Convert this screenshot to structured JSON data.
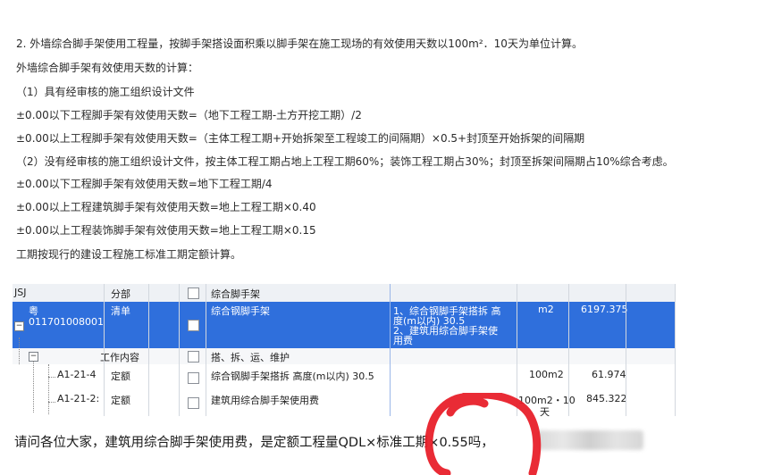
{
  "text_lines": [
    "2. 外墙综合脚手架使用工程量，按脚手架搭设面积乘以脚手架在施工现场的有效使用天数以100m²．10天为单位计算。",
    "外墙综合脚手架有效使用天数的计算：",
    "（1）具有经审核的施工组织设计文件",
    "±0.00以下工程脚手架有效使用天数=（地下工程工期-土方开挖工期）/2",
    "±0.00以上工程脚手架有效使用天数=（主体工程工期+开始拆架至工程竣工的间隔期）×0.5+封顶至开始拆架的间隔期",
    "（2）没有经审核的施工组织设计文件，按主体工程工期占地上工程工期60%；装饰工程工期占30%；封顶至拆架间隔期占10%综合考虑。",
    "±0.00以下工程脚手架有效使用天数=地下工程工期/4",
    "±0.00以上工程建筑脚手架有效使用天数=地上工程工期×0.40",
    "±0.00以上工程装饰脚手架有效使用天数=地上工程工期×0.15",
    "工期按现行的建设工程施工标准工期定额计算。"
  ],
  "grid": {
    "header": {
      "code": "JSJ",
      "type": "分部",
      "name": "综合脚手架"
    },
    "selected_row": {
      "code_line1": "粤",
      "code_line2": "011701008001",
      "type": "清单",
      "name": "综合钢脚手架",
      "feature_lines": [
        "1、综合钢脚手架搭拆 高",
        "度(m以内) 30.5",
        "2、建筑用综合脚手架使",
        "用费"
      ],
      "unit": "m2",
      "quantity": "6197.375"
    },
    "work_row": {
      "code": "工作内容",
      "name": "搭、拆、运、维护"
    },
    "rows": [
      {
        "code": "A1-21-4",
        "type": "定额",
        "name": "综合钢脚手架搭拆 高度(m以内) 30.5",
        "unit": "100m2",
        "quantity": "61.974"
      },
      {
        "code": "A1-21-2:",
        "type": "定额",
        "name": "建筑用综合脚手架使用费",
        "unit_line1": "100m2・10",
        "unit_line2": "天",
        "quantity": "845.322"
      }
    ]
  },
  "question": "请问各位大家，建筑用综合脚手架使用费，是定额工程量QDL×标准工期×0.55吗，",
  "colors": {
    "selected_row": "#2f6fdc",
    "annotation": "#e8202a"
  }
}
